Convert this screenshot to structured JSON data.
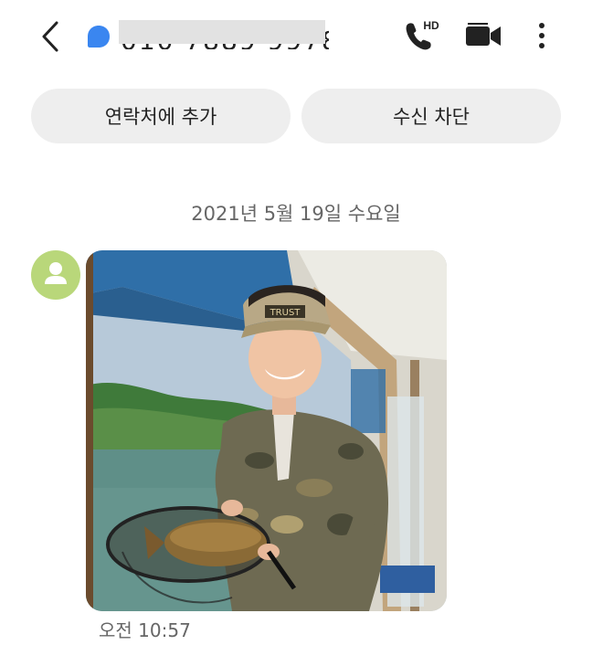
{
  "header": {
    "phone_number": "010 7889 9978",
    "icons": [
      "back-icon",
      "contact-dot-icon",
      "hd-call-icon",
      "video-call-icon",
      "more-options-icon"
    ],
    "call_badge": "HD"
  },
  "actions": {
    "add_contact_label": "연락처에 추가",
    "block_label": "수신 차단"
  },
  "conversation": {
    "date_separator": "2021년 5월 19일 수요일",
    "messages": [
      {
        "type": "image",
        "time": "오전 10:57",
        "cap_text": "TRUST"
      }
    ]
  },
  "colors": {
    "accent_blue": "#3a86f0",
    "avatar_green": "#b9d77a",
    "pill_bg": "#eeeeee",
    "secondary_text": "#666666"
  }
}
